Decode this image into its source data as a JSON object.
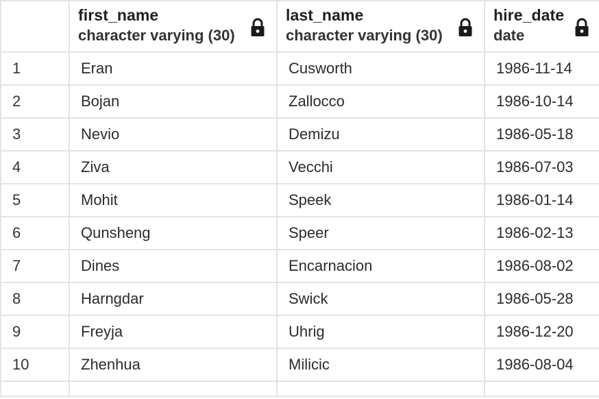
{
  "columns": [
    {
      "name": "first_name",
      "type": "character varying (30)",
      "icon": "lock-icon"
    },
    {
      "name": "last_name",
      "type": "character varying (30)",
      "icon": "lock-icon"
    },
    {
      "name": "hire_date",
      "type": "date",
      "icon": "lock-icon"
    }
  ],
  "rows": [
    {
      "index": "1",
      "first_name": "Eran",
      "last_name": "Cusworth",
      "hire_date": "1986-11-14"
    },
    {
      "index": "2",
      "first_name": "Bojan",
      "last_name": "Zallocco",
      "hire_date": "1986-10-14"
    },
    {
      "index": "3",
      "first_name": "Nevio",
      "last_name": "Demizu",
      "hire_date": "1986-05-18"
    },
    {
      "index": "4",
      "first_name": "Ziva",
      "last_name": "Vecchi",
      "hire_date": "1986-07-03"
    },
    {
      "index": "5",
      "first_name": "Mohit",
      "last_name": "Speek",
      "hire_date": "1986-01-14"
    },
    {
      "index": "6",
      "first_name": "Qunsheng",
      "last_name": "Speer",
      "hire_date": "1986-02-13"
    },
    {
      "index": "7",
      "first_name": "Dines",
      "last_name": "Encarnacion",
      "hire_date": "1986-08-02"
    },
    {
      "index": "8",
      "first_name": "Harngdar",
      "last_name": "Swick",
      "hire_date": "1986-05-28"
    },
    {
      "index": "9",
      "first_name": "Freyja",
      "last_name": "Uhrig",
      "hire_date": "1986-12-20"
    },
    {
      "index": "10",
      "first_name": "Zhenhua",
      "last_name": "Milicic",
      "hire_date": "1986-08-04"
    }
  ],
  "colors": {
    "grid_line": "#e3e3e3",
    "text": "#2b2b2b",
    "header_text": "#1f1f1f"
  }
}
